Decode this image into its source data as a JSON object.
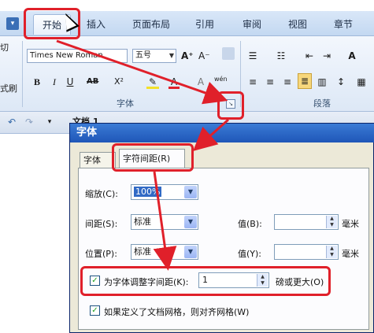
{
  "ribbon": {
    "tabs": [
      "开始",
      "插入",
      "页面布局",
      "引用",
      "审阅",
      "视图",
      "章节"
    ],
    "active_tab": "开始",
    "font_name": "Times New Roman",
    "font_size": "五号",
    "clipboard_fragments": [
      "切",
      "式刷"
    ],
    "group_font_label": "字体",
    "group_paragraph_label": "段落",
    "btn_bold": "B",
    "btn_italic": "I",
    "btn_underline": "U",
    "btn_strike": "AB",
    "btn_super": "X²",
    "btn_grow": "A⁺",
    "btn_shrink": "A⁻",
    "btn_wen": "wén",
    "btn_a_color": "A"
  },
  "docbar": {
    "partial_text": "文档 1"
  },
  "dialog": {
    "title": "字体",
    "tabs": [
      "字体(N)",
      "字符间距(R)"
    ],
    "active_tab": "字符间距(R)",
    "scale": {
      "label": "缩放(C):",
      "value": "100%"
    },
    "spacing": {
      "label": "间距(S):",
      "value": "标准",
      "value_label": "值(B):",
      "unit": "毫米"
    },
    "position": {
      "label": "位置(P):",
      "value": "标准",
      "value_label": "值(Y):",
      "unit": "毫米"
    },
    "kerning": {
      "checked": true,
      "label": "为字体调整字间距(K):",
      "value": "1",
      "suffix": "磅或更大(O)"
    },
    "grid": {
      "checked": true,
      "label": "如果定义了文档网格，则对齐网格(W)"
    }
  },
  "colors": {
    "annotation_red": "#e0202a",
    "dialog_title": "#2a66c8",
    "ribbon_bg": "#dde8f6"
  }
}
